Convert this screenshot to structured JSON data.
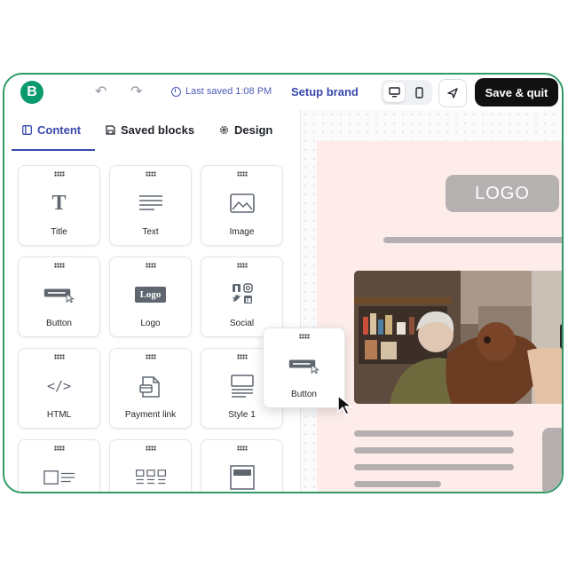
{
  "topbar": {
    "brand_letter": "B",
    "last_saved": "Last saved 1:08 PM",
    "setup_brand": "Setup brand",
    "save_quit": "Save & quit",
    "brand_color": "#0b996e",
    "accent_color": "#3949ab"
  },
  "tabs": [
    {
      "label": "Content",
      "icon": "panel-icon",
      "active": true
    },
    {
      "label": "Saved blocks",
      "icon": "save-icon",
      "active": false
    },
    {
      "label": "Design",
      "icon": "gear-icon",
      "active": false
    }
  ],
  "blocks": [
    {
      "label": "Title",
      "icon": "title-icon"
    },
    {
      "label": "Text",
      "icon": "text-icon"
    },
    {
      "label": "Image",
      "icon": "image-icon"
    },
    {
      "label": "Button",
      "icon": "button-icon"
    },
    {
      "label": "Logo",
      "icon": "logo-icon",
      "icon_text": "Logo"
    },
    {
      "label": "Social",
      "icon": "social-icon"
    },
    {
      "label": "HTML",
      "icon": "html-icon",
      "icon_text": "</>"
    },
    {
      "label": "Payment link",
      "icon": "payment-link-icon"
    },
    {
      "label": "Style 1",
      "icon": "style-icon"
    }
  ],
  "dragging_block": {
    "label": "Button"
  },
  "email": {
    "logo_text": "LOGO",
    "background": "#fdecea"
  }
}
